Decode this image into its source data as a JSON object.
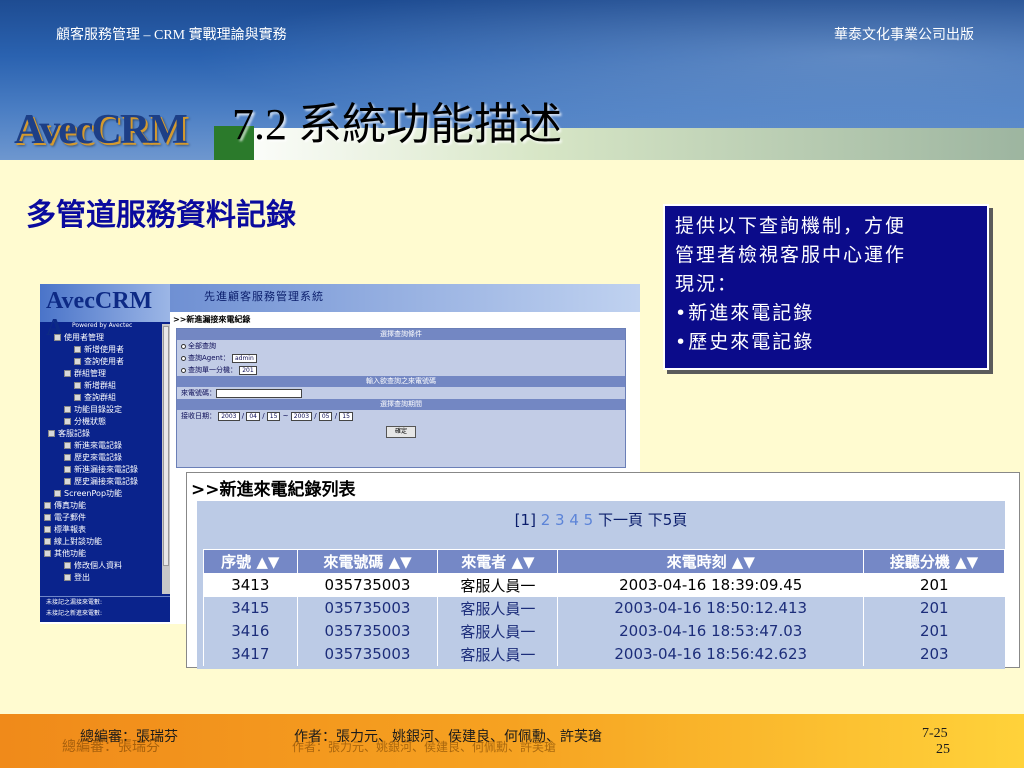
{
  "header": {
    "top_left": "顧客服務管理 – CRM 實戰理論與實務",
    "top_right": "華泰文化事業公司出版",
    "logo_text": "AvecCRM",
    "title": "7.2 系統功能描述"
  },
  "subtitle": "多管道服務資料記錄",
  "info_box": {
    "lines": [
      "提供以下查詢機制，方便",
      "管理者檢視客服中心運作",
      "現況："
    ],
    "bullets": [
      "•新進來電記錄",
      "•歷史來電記錄"
    ]
  },
  "app": {
    "sidebar_logo": "AvecCRM A",
    "powered": "Powered by Avectec",
    "tree": [
      "使用者管理",
      "新增使用者",
      "查詢使用者",
      "群組管理",
      "新增群組",
      "查詢群組",
      "功能目錄設定",
      "分機狀態",
      "客服記錄",
      "新進來電記錄",
      "歷史來電記錄",
      "新進漏接來電記錄",
      "歷史漏接來電記錄",
      "ScreenPop功能",
      "傳真功能",
      "電子郵件",
      "標準報表",
      "線上對談功能",
      "其他功能",
      "修改個人資料",
      "登出"
    ],
    "foot_lines": [
      "未接記之漏接來電數:",
      "未接記之新進來電數:"
    ],
    "topbar_title": "先進顧客服務管理系統",
    "section_title": ">>新進漏接來電紀錄",
    "form": {
      "bar1": "選擇查詢條件",
      "radio1": "全部查詢",
      "radio2": "查詢Agent：",
      "radio2_value": "admin",
      "radio3": "查詢單一分機：",
      "radio3_value": "201",
      "bar2": "輸入欲查詢之來電號碼",
      "phone_label": "來電號碼：",
      "bar3": "選擇查詢期間",
      "date_label": "接收日期：",
      "date_from": [
        "2003",
        "04",
        "15"
      ],
      "date_to": [
        "2003",
        "05",
        "15"
      ],
      "submit": "確定"
    }
  },
  "calllist": {
    "title": ">>新進來電紀錄列表",
    "pager": {
      "current": "[1]",
      "pages": "2 3 4 5",
      "next": "下一頁",
      "last5": "下5頁"
    },
    "columns": [
      "序號 ▲▼",
      "來電號碼 ▲▼",
      "來電者 ▲▼",
      "來電時刻 ▲▼",
      "接聽分機 ▲▼"
    ],
    "rows": [
      [
        "3413",
        "035735003",
        "客服人員一",
        "2003-04-16 18:39:09.45",
        "201"
      ],
      [
        "3415",
        "035735003",
        "客服人員一",
        "2003-04-16 18:50:12.413",
        "201"
      ],
      [
        "3416",
        "035735003",
        "客服人員一",
        "2003-04-16 18:53:47.03",
        "201"
      ],
      [
        "3417",
        "035735003",
        "客服人員一",
        "2003-04-16 18:56:42.623",
        "203"
      ]
    ]
  },
  "footer": {
    "editor": "總編審：張瑞芬",
    "authors": "作者：張力元、姚銀河、侯建良、何佩勳、許芙瑲",
    "chapter_page": "7-25",
    "page_number": "25"
  },
  "colors": {
    "body_bg": "#fffbd0",
    "subtitle": "#0a0a9e",
    "info_box": "#0b0b8a",
    "footer_start": "#f08a1a",
    "footer_end": "#ffd23a"
  }
}
